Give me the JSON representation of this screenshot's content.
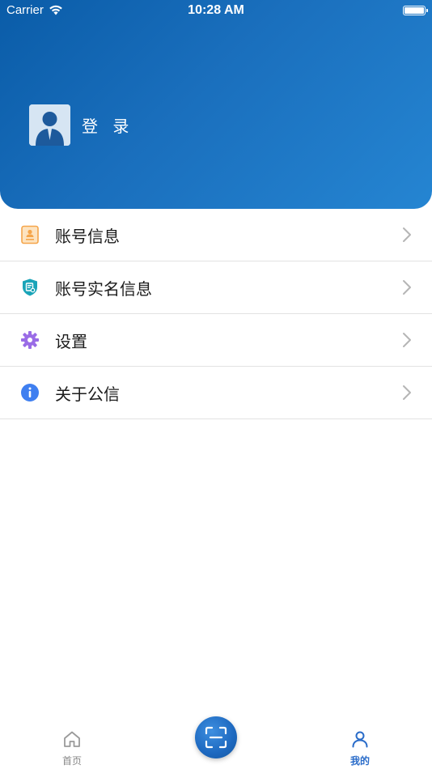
{
  "status_bar": {
    "carrier": "Carrier",
    "time": "10:28 AM"
  },
  "profile": {
    "login_label": "登 录"
  },
  "menu": {
    "items": [
      {
        "label": "账号信息",
        "icon": "account-card-icon"
      },
      {
        "label": "账号实名信息",
        "icon": "shield-id-icon"
      },
      {
        "label": "设置",
        "icon": "gear-icon"
      },
      {
        "label": "关于公信",
        "icon": "info-icon"
      }
    ]
  },
  "tabbar": {
    "home_label": "首页",
    "mine_label": "我的",
    "active": "mine"
  },
  "colors": {
    "header_start": "#0a5ca8",
    "header_end": "#2585d2",
    "accent": "#2a6cc9",
    "inactive": "#888888"
  }
}
